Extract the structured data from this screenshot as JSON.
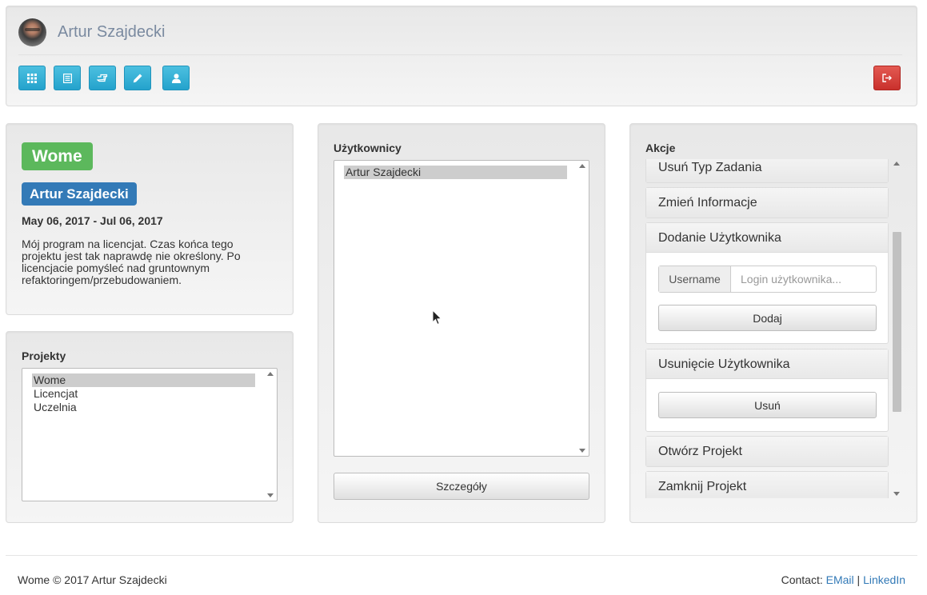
{
  "header": {
    "user_name": "Artur Szajdecki",
    "toolbar": [
      {
        "icon": "grid-icon",
        "name": "toolbar-grid-button"
      },
      {
        "icon": "list-icon",
        "name": "toolbar-list-button"
      },
      {
        "icon": "hand-pointer-icon",
        "name": "toolbar-hand-button"
      },
      {
        "icon": "pencil-icon",
        "name": "toolbar-edit-button"
      },
      {
        "icon": "user-icon",
        "name": "toolbar-user-button"
      }
    ],
    "logout_icon": "logout-icon"
  },
  "project_info": {
    "project_label": "Wome",
    "owner_label": "Artur Szajdecki",
    "dates": "May 06, 2017 - Jul 06, 2017",
    "description": "Mój program na licencjat. Czas końca tego projektu jest tak naprawdę nie określony. Po licencjacie pomyśleć nad gruntownym refaktoringem/przebudowaniem."
  },
  "projects": {
    "title": "Projekty",
    "items": [
      "Wome",
      "Licencjat",
      "Uczelnia"
    ],
    "selected": "Wome"
  },
  "users": {
    "title": "Użytkownicy",
    "items": [
      "Artur Szajdecki"
    ],
    "selected": "Artur Szajdecki",
    "details_button": "Szczegóły"
  },
  "actions": {
    "title": "Akcje",
    "panels": [
      {
        "title": "Usuń Typ Zadania"
      },
      {
        "title": "Zmień Informacje"
      },
      {
        "title": "Dodanie Użytkownika",
        "addon": "Username",
        "placeholder": "Login użytkownika...",
        "button": "Dodaj"
      },
      {
        "title": "Usunięcie Użytkownika",
        "button": "Usuń"
      },
      {
        "title": "Otwórz Projekt"
      },
      {
        "title": "Zamknij Projekt"
      }
    ]
  },
  "footer": {
    "copyright": "Wome © 2017 Artur Szajdecki",
    "contact_label": "Contact:",
    "email_link": "EMail",
    "separator": "|",
    "linkedin_link": "LinkedIn"
  },
  "colors": {
    "toolbar_button": "#24a2cc",
    "logout_button": "#c9302c",
    "project_label": "#5cb85c",
    "owner_label": "#337ab7",
    "link": "#337ab7"
  }
}
